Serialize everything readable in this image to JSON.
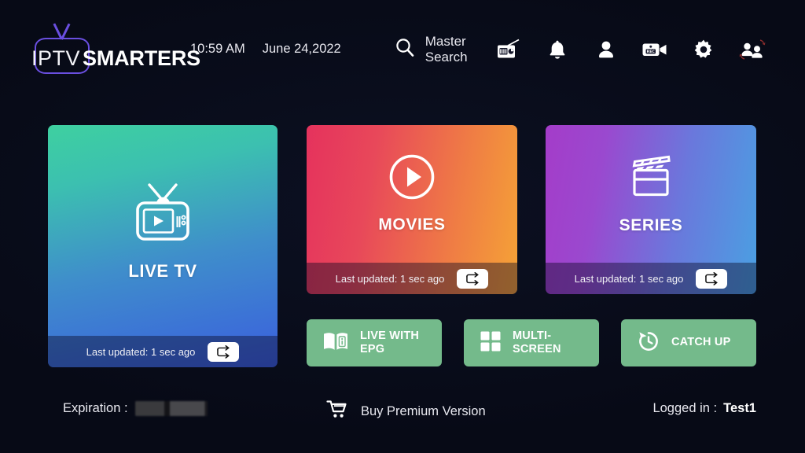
{
  "app": {
    "logo_primary": "IPTV",
    "logo_secondary": "SMARTERS",
    "background_color": "#070a16"
  },
  "header": {
    "time": "10:59 AM",
    "date": "June 24,2022",
    "search": {
      "icon": "search-icon",
      "label": "Master Search"
    },
    "icons": [
      {
        "name": "radio-icon",
        "label": "Radio"
      },
      {
        "name": "bell-icon",
        "label": "Notifications"
      },
      {
        "name": "user-icon",
        "label": "Account"
      },
      {
        "name": "rec-camera-icon",
        "label": "Recordings"
      },
      {
        "name": "gear-icon",
        "label": "Settings"
      },
      {
        "name": "switch-user-icon",
        "label": "Switch User"
      }
    ]
  },
  "cards": [
    {
      "id": "live-tv",
      "title": "LIVE TV",
      "icon": "retro-tv-icon",
      "updated_text": "Last updated: 1 sec ago",
      "refresh_icon": "refresh-repeat-icon",
      "gradient_from": "#3ed0a0",
      "gradient_to": "#3a5ede"
    },
    {
      "id": "movies",
      "title": "MOVIES",
      "icon": "play-circle-icon",
      "updated_text": "Last updated: 1 sec ago",
      "refresh_icon": "refresh-repeat-icon",
      "gradient_from": "#e5325d",
      "gradient_to": "#f5a336"
    },
    {
      "id": "series",
      "title": "SERIES",
      "icon": "clapperboard-icon",
      "updated_text": "Last updated: 1 sec ago",
      "refresh_icon": "refresh-repeat-icon",
      "gradient_from": "#a43cc9",
      "gradient_to": "#4aa0e2"
    }
  ],
  "actions": {
    "button_color": "#74ba8b",
    "items": [
      {
        "id": "live-with-epg",
        "label": "LIVE WITH EPG",
        "icon": "book-info-icon"
      },
      {
        "id": "multi-screen",
        "label": "MULTI-SCREEN",
        "icon": "grid-squares-icon"
      },
      {
        "id": "catch-up",
        "label": "CATCH UP",
        "icon": "clock-rewind-icon"
      }
    ]
  },
  "footer": {
    "expiration_label": "Expiration :",
    "expiration_value": "",
    "buy_label": "Buy Premium Version",
    "buy_icon": "cart-icon",
    "logged_in_label": "Logged in :",
    "logged_in_user": "Test1"
  }
}
